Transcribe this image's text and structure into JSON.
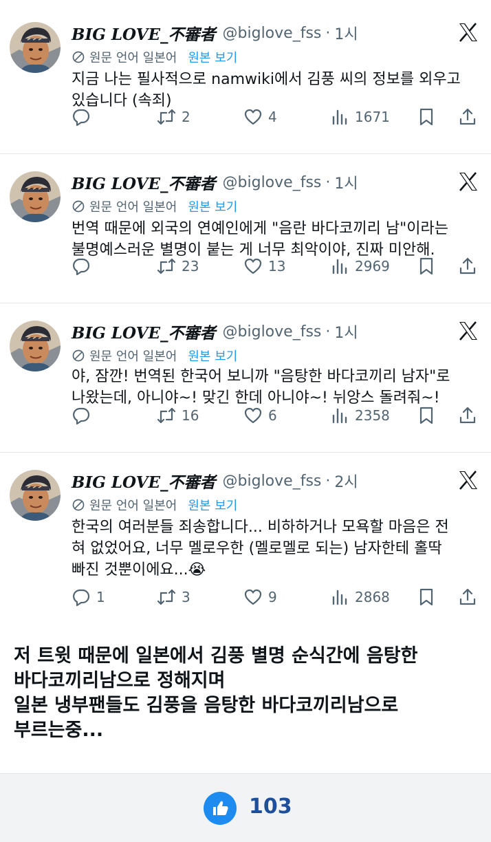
{
  "tweets": [
    {
      "name": "BIG LOVE_不審者",
      "handle": "@biglove_fss",
      "time": "1시",
      "translation_label": "원문 언어 일본어",
      "translation_link": "원본 보기",
      "lines": [
        "지금 나는 필사적으로 namwiki에서 김풍 씨의 정보를 외우고",
        "있습니다 (속죄)"
      ],
      "replies": "",
      "retweets": "2",
      "likes": "4",
      "views": "1671"
    },
    {
      "name": "BIG LOVE_不審者",
      "handle": "@biglove_fss",
      "time": "1시",
      "translation_label": "원문 언어 일본어",
      "translation_link": "원본 보기",
      "lines": [
        "번역 때문에 외국의 연예인에게 \"음란 바다코끼리 남\"이라는",
        "불명예스러운 별명이 붙는 게 너무 최악이야, 진짜 미안해."
      ],
      "replies": "",
      "retweets": "23",
      "likes": "13",
      "views": "2969"
    },
    {
      "name": "BIG LOVE_不審者",
      "handle": "@biglove_fss",
      "time": "1시",
      "translation_label": "원문 언어 일본어",
      "translation_link": "원본 보기",
      "lines": [
        "야, 잠깐! 번역된 한국어 보니까 \"음탕한 바다코끼리 남자\"로",
        "나왔는데, 아니야~! 맞긴 한데 아니야~! 뉘앙스 돌려줘~!"
      ],
      "replies": "",
      "retweets": "16",
      "likes": "6",
      "views": "2358"
    },
    {
      "name": "BIG LOVE_不審者",
      "handle": "@biglove_fss",
      "time": "2시",
      "translation_label": "원문 언어 일본어",
      "translation_link": "원본 보기",
      "lines": [
        "한국의 여러분들 죄송합니다... 비하하거나 모욕할 마음은 전",
        "혀 없었어요, 너무 멜로우한 (멜로멜로 되는) 남자한테 홀딱",
        "빠진 것뿐이에요...😭"
      ],
      "replies": "1",
      "retweets": "3",
      "likes": "9",
      "views": "2868"
    }
  ],
  "caption": {
    "lines": [
      "저 트윗 때문에 일본에서 김풍 별명 순식간에 음탕한",
      "바다코끼리남으로 정해지며",
      "일본 냉부팬들도 김풍을 음탕한 바다코끼리남으로",
      "부르는중..."
    ]
  },
  "like_bar": {
    "count": "103",
    "icon": "thumbs-up-icon"
  },
  "colors": {
    "link": "#1d9bf0",
    "muted": "#536471",
    "like_button": "#1d8bf0",
    "like_count": "#1f4f9a"
  }
}
